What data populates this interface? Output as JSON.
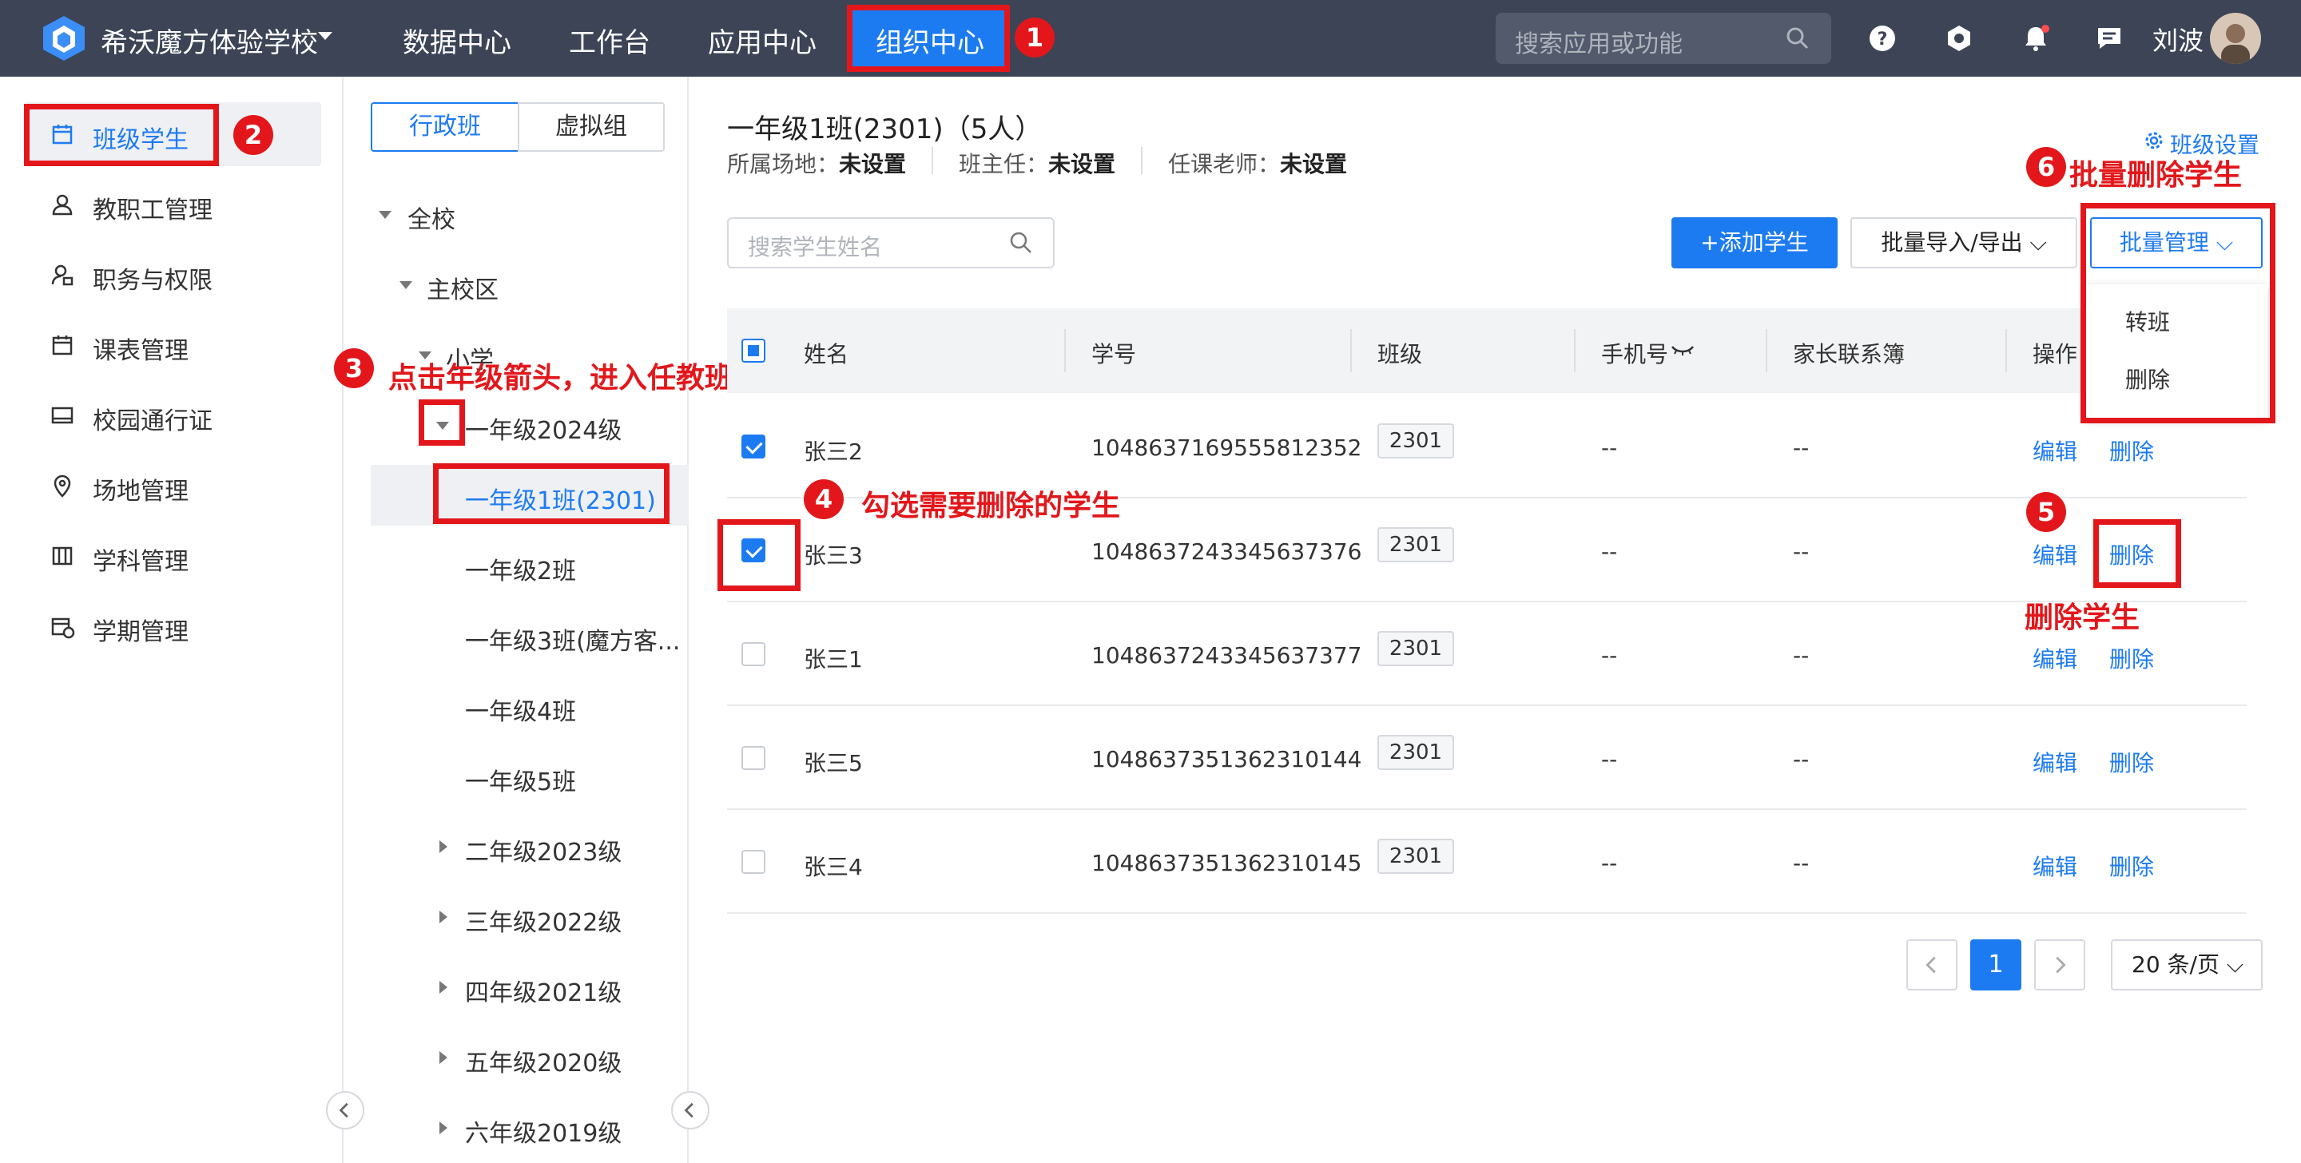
{
  "app": {
    "school_name": "希沃魔方体验学校"
  },
  "nav": {
    "items": [
      "数据中心",
      "工作台",
      "应用中心",
      "组织中心"
    ]
  },
  "top_search": {
    "placeholder": "搜索应用或功能"
  },
  "user": {
    "name": "刘波"
  },
  "sidebar": {
    "items": [
      "班级学生",
      "教职工管理",
      "职务与权限",
      "课表管理",
      "校园通行证",
      "场地管理",
      "学科管理",
      "学期管理"
    ]
  },
  "tree": {
    "tabs": [
      "行政班",
      "虚拟组"
    ],
    "nodes": [
      "全校",
      "主校区",
      "小学",
      "一年级2024级",
      "一年级1班(2301)",
      "一年级2班",
      "一年级3班(魔方客...",
      "一年级4班",
      "一年级5班",
      "二年级2023级",
      "三年级2022级",
      "四年级2021级",
      "五年级2020级",
      "六年级2019级"
    ]
  },
  "class_info": {
    "title": "一年级1班(2301)（5人）",
    "venue_label": "所属场地：",
    "venue_value": "未设置",
    "head_label": "班主任：",
    "head_value": "未设置",
    "teacher_label": "任课老师：",
    "teacher_value": "未设置",
    "settings_link": "班级设置"
  },
  "toolbar": {
    "search_placeholder": "搜索学生姓名",
    "add_label": "+添加学生",
    "import_label": "批量导入/导出",
    "batch_label": "批量管理"
  },
  "batch_menu": [
    "转班",
    "删除"
  ],
  "table": {
    "headers": [
      "姓名",
      "学号",
      "班级",
      "手机号",
      "家长联系簿",
      "操作"
    ],
    "rows": [
      {
        "name": "张三2",
        "id": "1048637169555812352",
        "class": "2301",
        "phone": "--",
        "parent": "--",
        "checked": true
      },
      {
        "name": "张三3",
        "id": "1048637243345637376",
        "class": "2301",
        "phone": "--",
        "parent": "--",
        "checked": true
      },
      {
        "name": "张三1",
        "id": "1048637243345637377",
        "class": "2301",
        "phone": "--",
        "parent": "--",
        "checked": false
      },
      {
        "name": "张三5",
        "id": "1048637351362310144",
        "class": "2301",
        "phone": "--",
        "parent": "--",
        "checked": false
      },
      {
        "name": "张三4",
        "id": "1048637351362310145",
        "class": "2301",
        "phone": "--",
        "parent": "--",
        "checked": false
      }
    ],
    "edit_label": "编辑",
    "delete_label": "删除"
  },
  "pagination": {
    "current": "1",
    "page_size": "20 条/页"
  },
  "annotations": {
    "steps": [
      "1",
      "2",
      "3",
      "4",
      "5",
      "6"
    ],
    "step3": "点击年级箭头，进入任教班级",
    "step4": "勾选需要删除的学生",
    "step5": "删除学生",
    "step6": "批量删除学生"
  },
  "colors": {
    "accent": "#1d7bf2",
    "topbar": "#3c4456",
    "annotation": "#e3171b"
  }
}
